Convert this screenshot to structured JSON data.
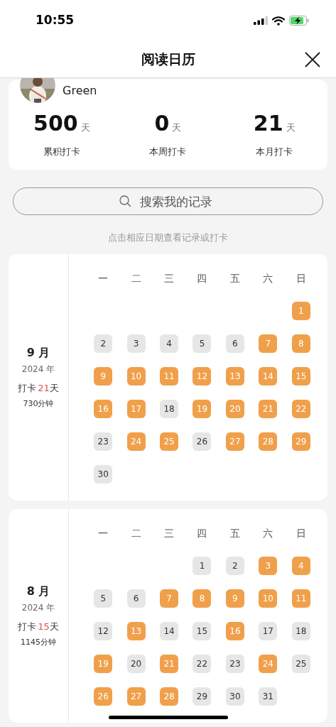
{
  "status_bar": {
    "time": "10:55"
  },
  "header": {
    "title": "阅读日历"
  },
  "profile": {
    "name": "Green",
    "stats": [
      {
        "value": "500",
        "unit": "天",
        "label": "累积打卡"
      },
      {
        "value": "0",
        "unit": "天",
        "label": "本周打卡"
      },
      {
        "value": "21",
        "unit": "天",
        "label": "本月打卡"
      }
    ]
  },
  "search": {
    "placeholder": "搜索我的记录"
  },
  "hint": "点击相应日期查看记录或打卡",
  "months": [
    {
      "month": "9 月",
      "year": "2024 年",
      "checkin": {
        "prefix": "打卡",
        "count": "21",
        "suffix": "天"
      },
      "minutes": "730分钟",
      "weekdays": [
        "一",
        "二",
        "三",
        "四",
        "五",
        "六",
        "日"
      ],
      "weeks": [
        [
          {
            "kind": "empty"
          },
          {
            "kind": "empty"
          },
          {
            "kind": "empty"
          },
          {
            "kind": "empty"
          },
          {
            "kind": "empty"
          },
          {
            "kind": "empty"
          },
          {
            "kind": "day",
            "label": "1",
            "highlighted": true
          }
        ],
        [
          {
            "kind": "day",
            "label": "2",
            "highlighted": false
          },
          {
            "kind": "day",
            "label": "3",
            "highlighted": false
          },
          {
            "kind": "day",
            "label": "4",
            "highlighted": false
          },
          {
            "kind": "day",
            "label": "5",
            "highlighted": false
          },
          {
            "kind": "day",
            "label": "6",
            "highlighted": false
          },
          {
            "kind": "day",
            "label": "7",
            "highlighted": true
          },
          {
            "kind": "day",
            "label": "8",
            "highlighted": true
          }
        ],
        [
          {
            "kind": "day",
            "label": "9",
            "highlighted": true
          },
          {
            "kind": "day",
            "label": "10",
            "highlighted": true
          },
          {
            "kind": "day",
            "label": "11",
            "highlighted": true
          },
          {
            "kind": "day",
            "label": "12",
            "highlighted": true
          },
          {
            "kind": "day",
            "label": "13",
            "highlighted": true
          },
          {
            "kind": "day",
            "label": "14",
            "highlighted": true
          },
          {
            "kind": "day",
            "label": "15",
            "highlighted": true
          }
        ],
        [
          {
            "kind": "day",
            "label": "16",
            "highlighted": true
          },
          {
            "kind": "day",
            "label": "17",
            "highlighted": true
          },
          {
            "kind": "day",
            "label": "18",
            "highlighted": false
          },
          {
            "kind": "day",
            "label": "19",
            "highlighted": true
          },
          {
            "kind": "day",
            "label": "20",
            "highlighted": true
          },
          {
            "kind": "day",
            "label": "21",
            "highlighted": true
          },
          {
            "kind": "day",
            "label": "22",
            "highlighted": true
          }
        ],
        [
          {
            "kind": "day",
            "label": "23",
            "highlighted": false
          },
          {
            "kind": "day",
            "label": "24",
            "highlighted": true
          },
          {
            "kind": "day",
            "label": "25",
            "highlighted": true
          },
          {
            "kind": "day",
            "label": "26",
            "highlighted": false
          },
          {
            "kind": "day",
            "label": "27",
            "highlighted": true
          },
          {
            "kind": "day",
            "label": "28",
            "highlighted": true
          },
          {
            "kind": "day",
            "label": "29",
            "highlighted": true
          }
        ],
        [
          {
            "kind": "day",
            "label": "30",
            "highlighted": false
          }
        ]
      ]
    },
    {
      "month": "8 月",
      "year": "2024 年",
      "checkin": {
        "prefix": "打卡",
        "count": "15",
        "suffix": "天"
      },
      "minutes": "1145分钟",
      "weekdays": [
        "一",
        "二",
        "三",
        "四",
        "五",
        "六",
        "日"
      ],
      "weeks": [
        [
          {
            "kind": "empty"
          },
          {
            "kind": "empty"
          },
          {
            "kind": "empty"
          },
          {
            "kind": "day",
            "label": "1",
            "highlighted": false
          },
          {
            "kind": "day",
            "label": "2",
            "highlighted": false
          },
          {
            "kind": "day",
            "label": "3",
            "highlighted": true
          },
          {
            "kind": "day",
            "label": "4",
            "highlighted": true
          }
        ],
        [
          {
            "kind": "day",
            "label": "5",
            "highlighted": false
          },
          {
            "kind": "day",
            "label": "6",
            "highlighted": false
          },
          {
            "kind": "day",
            "label": "7",
            "highlighted": true
          },
          {
            "kind": "day",
            "label": "8",
            "highlighted": true
          },
          {
            "kind": "day",
            "label": "9",
            "highlighted": true
          },
          {
            "kind": "day",
            "label": "10",
            "highlighted": true
          },
          {
            "kind": "day",
            "label": "11",
            "highlighted": true
          }
        ],
        [
          {
            "kind": "day",
            "label": "12",
            "highlighted": false
          },
          {
            "kind": "day",
            "label": "13",
            "highlighted": true
          },
          {
            "kind": "day",
            "label": "14",
            "highlighted": false
          },
          {
            "kind": "day",
            "label": "15",
            "highlighted": false
          },
          {
            "kind": "day",
            "label": "16",
            "highlighted": true
          },
          {
            "kind": "day",
            "label": "17",
            "highlighted": false
          },
          {
            "kind": "day",
            "label": "18",
            "highlighted": false
          }
        ],
        [
          {
            "kind": "day",
            "label": "19",
            "highlighted": true
          },
          {
            "kind": "day",
            "label": "20",
            "highlighted": false
          },
          {
            "kind": "day",
            "label": "21",
            "highlighted": true
          },
          {
            "kind": "day",
            "label": "22",
            "highlighted": false
          },
          {
            "kind": "day",
            "label": "23",
            "highlighted": false
          },
          {
            "kind": "day",
            "label": "24",
            "highlighted": true
          },
          {
            "kind": "day",
            "label": "25",
            "highlighted": false
          }
        ],
        [
          {
            "kind": "day",
            "label": "26",
            "highlighted": true
          },
          {
            "kind": "day",
            "label": "27",
            "highlighted": true
          },
          {
            "kind": "day",
            "label": "28",
            "highlighted": true
          },
          {
            "kind": "day",
            "label": "29",
            "highlighted": false
          },
          {
            "kind": "day",
            "label": "30",
            "highlighted": false
          },
          {
            "kind": "day",
            "label": "31",
            "highlighted": false
          }
        ]
      ]
    }
  ]
}
